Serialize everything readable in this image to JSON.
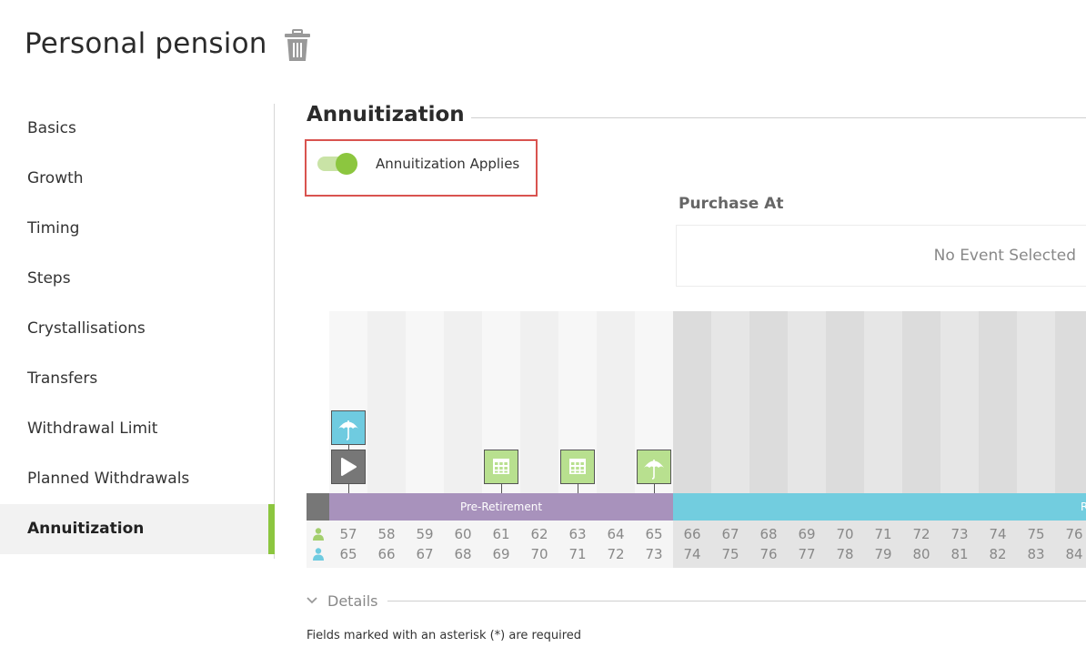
{
  "header": {
    "title": "Personal pension",
    "delete_icon": "trash-icon"
  },
  "sidebar": {
    "items": [
      {
        "label": "Basics",
        "active": false
      },
      {
        "label": "Growth",
        "active": false
      },
      {
        "label": "Timing",
        "active": false
      },
      {
        "label": "Steps",
        "active": false
      },
      {
        "label": "Crystallisations",
        "active": false
      },
      {
        "label": "Transfers",
        "active": false
      },
      {
        "label": "Withdrawal Limit",
        "active": false
      },
      {
        "label": "Planned Withdrawals",
        "active": false
      },
      {
        "label": "Annuitization",
        "active": true
      }
    ],
    "accent_color": "#8cc63f"
  },
  "section": {
    "title": "Annuitization",
    "toggle_label": "Annuitization Applies",
    "toggle_on": true
  },
  "purchase": {
    "label": "Purchase At",
    "placeholder": "No Event Selected"
  },
  "timeline": {
    "phases": [
      {
        "label": "Pre-Retirement",
        "color": "#a892bc"
      },
      {
        "label": "R",
        "color": "#72cddf"
      }
    ],
    "ages_person1": [
      57,
      58,
      59,
      60,
      61,
      62,
      63,
      64,
      65,
      66,
      67,
      68,
      69,
      70,
      71,
      72,
      73,
      74,
      75,
      76
    ],
    "ages_person2": [
      65,
      66,
      67,
      68,
      69,
      70,
      71,
      72,
      73,
      74,
      75,
      76,
      77,
      78,
      79,
      80,
      81,
      82,
      83,
      84
    ],
    "person1_color": "#a3cf6e",
    "person2_color": "#6fcbe0",
    "events": [
      {
        "icon": "umbrella-icon",
        "age": 57,
        "color": "#6fcbe0"
      },
      {
        "icon": "play-icon",
        "age": 57,
        "color": "#777777"
      },
      {
        "icon": "calendar-icon",
        "age": 61,
        "color": "#b8e08f"
      },
      {
        "icon": "calendar-icon",
        "age": 63,
        "color": "#b8e08f"
      },
      {
        "icon": "umbrella-icon",
        "age": 65,
        "color": "#b8e08f"
      }
    ]
  },
  "details": {
    "label": "Details"
  },
  "footer": {
    "required_note": "Fields marked with an asterisk (*) are required"
  }
}
